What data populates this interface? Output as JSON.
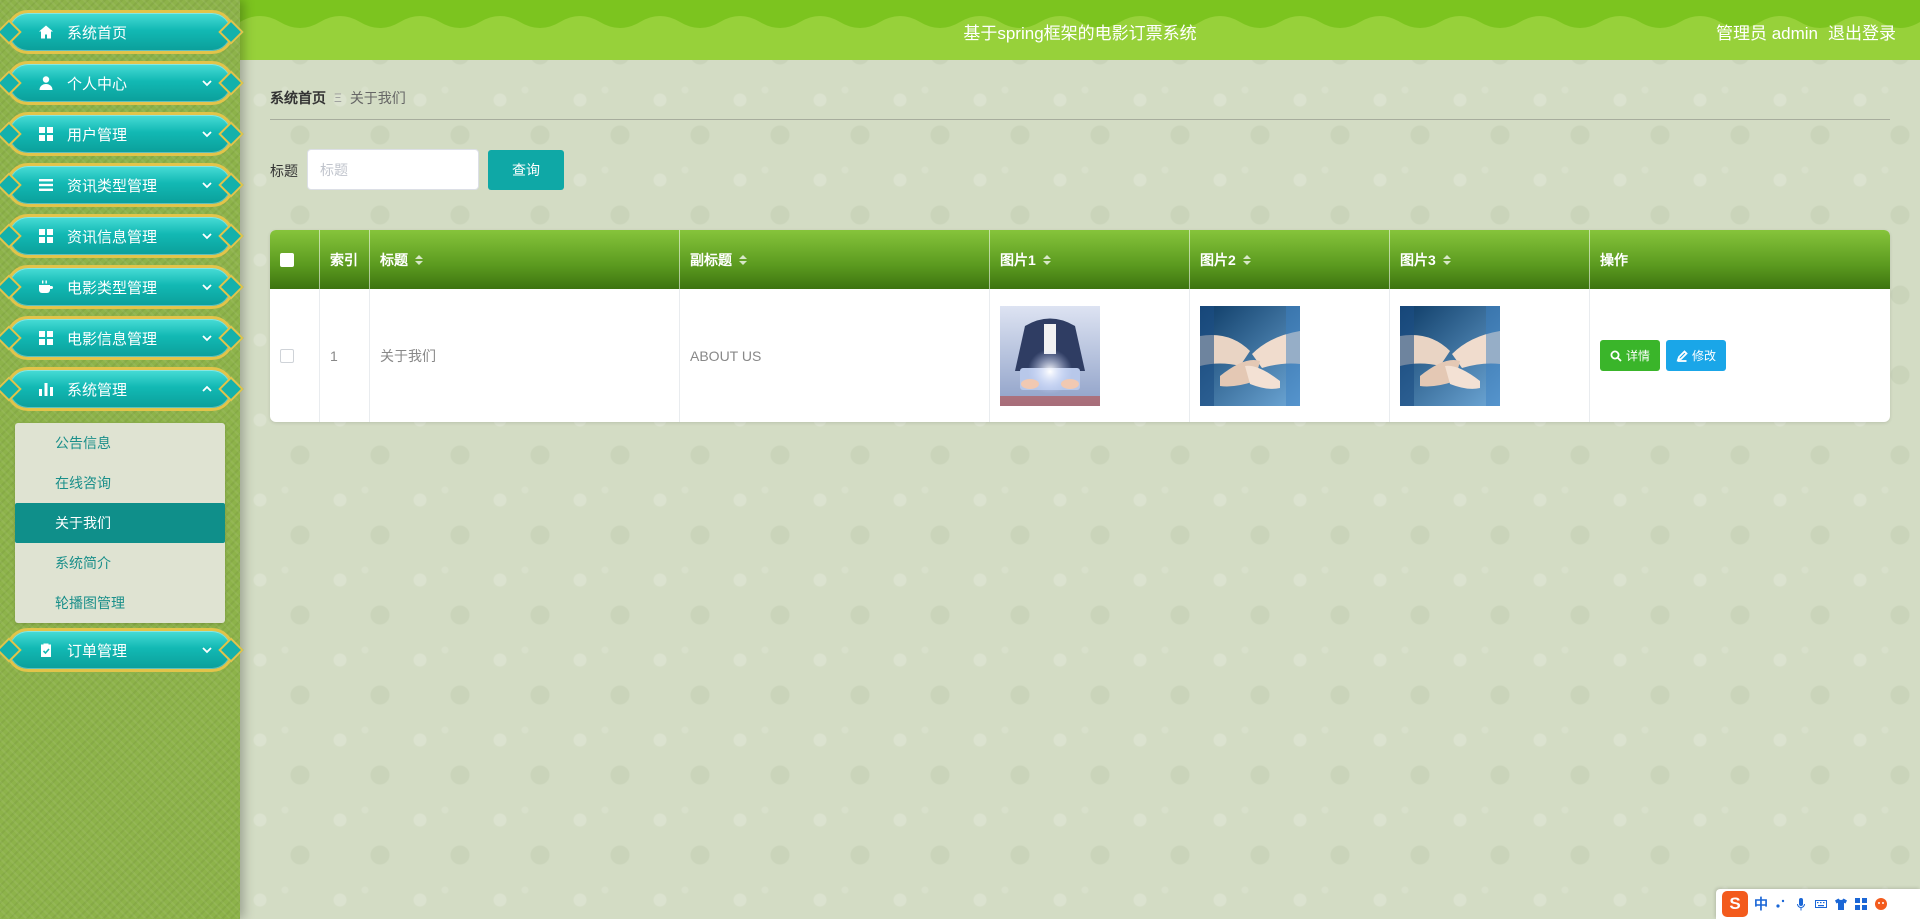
{
  "app": {
    "title": "基于spring框架的电影订票系统",
    "user": "管理员 admin",
    "logout": "退出登录"
  },
  "sidebar": {
    "items": [
      {
        "label": "系统首页",
        "icon": "home-icon"
      },
      {
        "label": "个人中心",
        "icon": "user-icon"
      },
      {
        "label": "用户管理",
        "icon": "grid-icon"
      },
      {
        "label": "资讯类型管理",
        "icon": "list-icon"
      },
      {
        "label": "资讯信息管理",
        "icon": "grid-icon"
      },
      {
        "label": "电影类型管理",
        "icon": "coffee-icon"
      },
      {
        "label": "电影信息管理",
        "icon": "grid-icon"
      },
      {
        "label": "系统管理",
        "icon": "bar-chart-icon",
        "expanded": true
      },
      {
        "label": "订单管理",
        "icon": "clipboard-icon"
      }
    ],
    "submenu": [
      {
        "label": "公告信息"
      },
      {
        "label": "在线咨询"
      },
      {
        "label": "关于我们",
        "active": true
      },
      {
        "label": "系统简介"
      },
      {
        "label": "轮播图管理"
      }
    ]
  },
  "breadcrumb": {
    "home": "系统首页",
    "separator": "Ξ",
    "current": "关于我们"
  },
  "search": {
    "label": "标题",
    "placeholder": "标题",
    "value": "",
    "button": "查询"
  },
  "table": {
    "columns": [
      "索引",
      "标题",
      "副标题",
      "图片1",
      "图片2",
      "图片3",
      "操作"
    ],
    "rows": [
      {
        "index": "1",
        "title": "关于我们",
        "subtitle": "ABOUT US",
        "images": [
          "business-hand-tablet",
          "team-hands-stack",
          "team-hands-stack"
        ]
      }
    ],
    "actions": {
      "detail": "详情",
      "edit": "修改"
    }
  },
  "ime": {
    "logo": "S",
    "mode": "中"
  },
  "colors": {
    "header": "#97d13a",
    "sidebar_bg": "#8db34a",
    "menu_teal": "#12b9b4",
    "menu_border": "#e2c44a",
    "active_sub": "#0f8f8a",
    "search_button": "#0fa8a6",
    "detail_button": "#3ab52a",
    "edit_button": "#1aa6e8"
  }
}
